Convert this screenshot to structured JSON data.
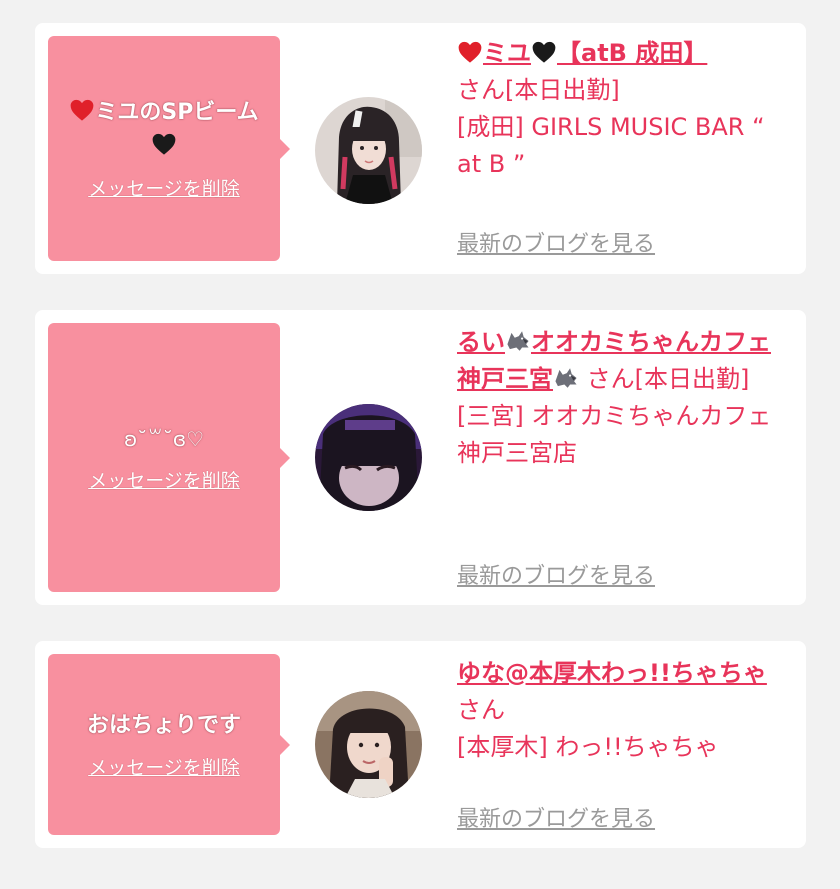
{
  "messages": [
    {
      "bubble_text": "ミユのSPビーム",
      "delete_label": "メッセージを削除",
      "girl_name": "ミユ",
      "shop_tag": "【atB 成田】",
      "suffix": "さん[本日出勤]",
      "shop_line": "[成田] GIRLS MUSIC BAR “ at B ”",
      "blog_label": "最新のブログを見る",
      "avatar_icon": "girl-avatar-photo",
      "heart_colors": {
        "red": "#e0202a",
        "black": "#1a1a1a"
      }
    },
    {
      "bubble_text": "ʚ˘꒳˘ɞ♡",
      "delete_label": "メッセージを削除",
      "girl_name": "るい",
      "name_part2": "オオカミちゃんカフェ神戸三宮",
      "suffix": "さん[本日出勤]",
      "shop_line": "[三宮] オオカミちゃんカフェ神戸三宮店",
      "blog_label": "最新のブログを見る",
      "avatar_icon": "girl-avatar-photo",
      "wolf_icon": "wolf-icon"
    },
    {
      "bubble_text": "おはちょりです",
      "delete_label": "メッセージを削除",
      "girl_name": "ゆな@本厚木わっ!!ちゃちゃ",
      "suffix": "さん",
      "shop_line": "[本厚木] わっ!!ちゃちゃ",
      "blog_label": "最新のブログを見る",
      "avatar_icon": "girl-avatar-photo"
    }
  ],
  "colors": {
    "accent": "#e8345a",
    "bubble": "#f8909f",
    "muted": "#9a9a9a",
    "background": "#f2f2f2"
  }
}
